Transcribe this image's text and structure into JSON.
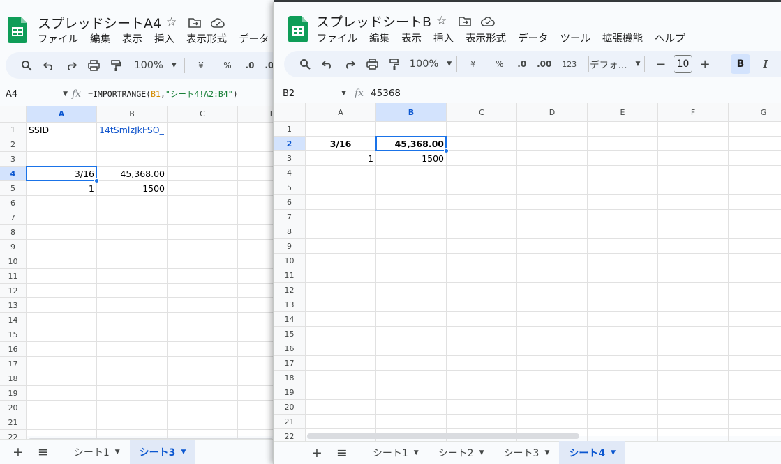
{
  "winA": {
    "title": "スプレッドシートA4",
    "menu": [
      "ファイル",
      "編集",
      "表示",
      "挿入",
      "表示形式",
      "データ"
    ],
    "zoom": "100%",
    "namebox": "A4",
    "formula_prefix": "=IMPORTRANGE(",
    "formula_ref": "B1",
    "formula_sep": ",",
    "formula_str": "\"シート4!A2:B4\"",
    "formula_suffix": ")",
    "columns": [
      "A",
      "B",
      "C",
      "D"
    ],
    "rows": [
      "1",
      "2",
      "3",
      "4",
      "5",
      "6",
      "7",
      "8",
      "9",
      "10",
      "11",
      "12",
      "13",
      "14",
      "15",
      "16",
      "17",
      "18",
      "19",
      "20",
      "21",
      "22"
    ],
    "cells": {
      "A1": "SSID",
      "B1": "14tSmlzJkFSO_",
      "A4": "3/16",
      "B4": "45,368.00",
      "A5": "1",
      "B5": "1500"
    },
    "tabs": [
      "シート1",
      "シート3"
    ],
    "active_tab": "シート3"
  },
  "winB": {
    "title": "スプレッドシートB",
    "menu": [
      "ファイル",
      "編集",
      "表示",
      "挿入",
      "表示形式",
      "データ",
      "ツール",
      "拡張機能",
      "ヘルプ"
    ],
    "zoom": "100%",
    "font": "デフォ...",
    "font_size": "10",
    "namebox": "B2",
    "formula": "45368",
    "columns": [
      "A",
      "B",
      "C",
      "D",
      "E",
      "F",
      "G"
    ],
    "rows": [
      "1",
      "2",
      "3",
      "4",
      "5",
      "6",
      "7",
      "8",
      "9",
      "10",
      "11",
      "12",
      "13",
      "14",
      "15",
      "16",
      "17",
      "18",
      "19",
      "20",
      "21",
      "22"
    ],
    "cells": {
      "A2": "3/16",
      "B2": "45,368.00",
      "A3": "1",
      "B3": "1500"
    },
    "tabs": [
      "シート1",
      "シート2",
      "シート3",
      "シート4"
    ],
    "active_tab": "シート4"
  },
  "toolbar_labels": {
    "currency": "¥",
    "percent": "%",
    "dec_minus": ".0",
    "dec_plus": ".00",
    "number_fmt": "123",
    "bold": "B",
    "italic": "I"
  },
  "colors": {
    "selection": "#1a73e8",
    "header_selected": "#d3e3fd",
    "link": "#1155cc",
    "logo_green": "#0f9d58"
  }
}
